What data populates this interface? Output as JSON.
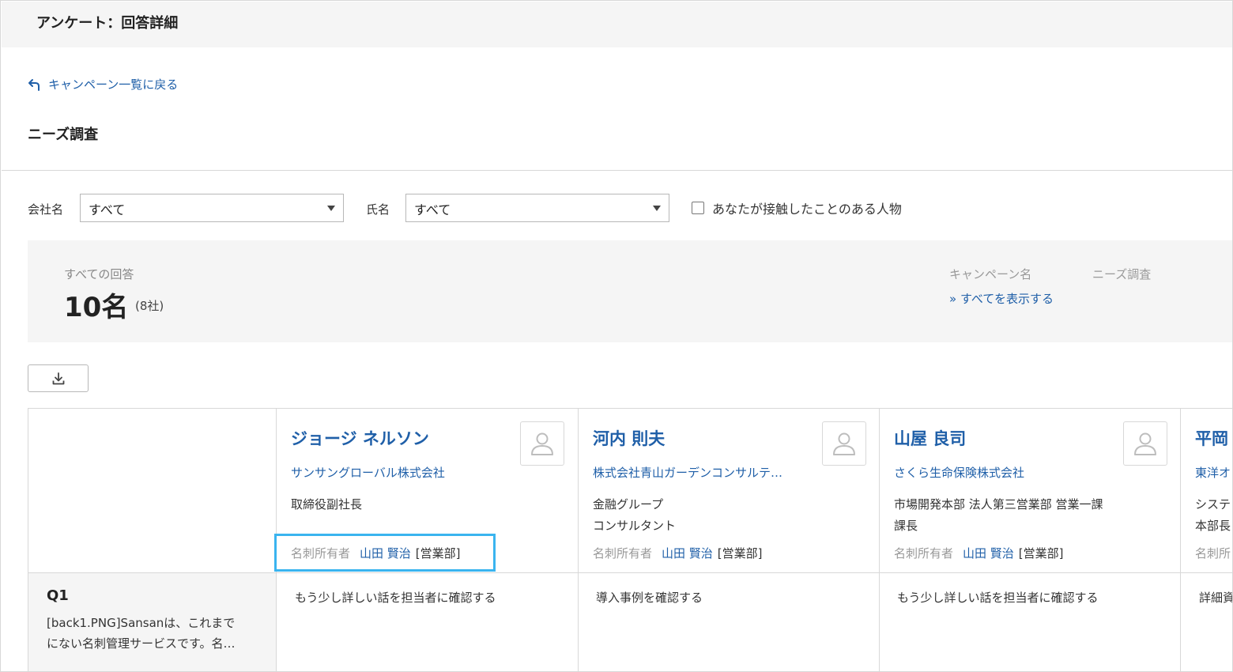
{
  "header": {
    "title": "アンケート：回答詳細"
  },
  "nav": {
    "back_label": "キャンペーン一覧に戻る"
  },
  "survey": {
    "title": "ニーズ調査"
  },
  "filters": {
    "company_label": "会社名",
    "company_value": "すべて",
    "name_label": "氏名",
    "name_value": "すべて",
    "contact_label": "あなたが接触したことのある人物"
  },
  "summary": {
    "label": "すべての回答",
    "count": "10名",
    "companies": "(8社)",
    "campaign_label": "キャンペーン名",
    "campaign_value": "ニーズ調査",
    "show_all": "» すべてを表示する"
  },
  "question": {
    "number": "Q1",
    "text_line1": "[back1.PNG]Sansanは、これまで",
    "text_line2": "にない名刺管理サービスです。名…"
  },
  "people": [
    {
      "name": "ジョージ ネルソン",
      "company": "サンサングローバル株式会社",
      "title_line1": "取締役副社長",
      "title_line2": "",
      "owner_label": "名刺所有者",
      "owner_name": "山田 賢治",
      "owner_dept": "[営業部]",
      "answer": "もう少し詳しい話を担当者に確認する"
    },
    {
      "name": "河内 則夫",
      "company": "株式会社青山ガーデンコンサルテ…",
      "title_line1": "金融グループ",
      "title_line2": "コンサルタント",
      "owner_label": "名刺所有者",
      "owner_name": "山田 賢治",
      "owner_dept": "[営業部]",
      "answer": "導入事例を確認する"
    },
    {
      "name": "山屋 良司",
      "company": "さくら生命保険株式会社",
      "title_line1": "市場開発本部 法人第三営業部 営業一課",
      "title_line2": "課長",
      "owner_label": "名刺所有者",
      "owner_name": "山田 賢治",
      "owner_dept": "[営業部]",
      "answer": "もう少し詳しい話を担当者に確認する"
    },
    {
      "name": "平岡",
      "company": "東洋オ",
      "title_line1": "システ",
      "title_line2": "本部長",
      "owner_label": "名刺所",
      "owner_name": "",
      "owner_dept": "",
      "answer": "詳細資"
    }
  ],
  "colors": {
    "link": "#1f5fa8",
    "highlight": "#3ab4ef",
    "panel": "#f5f5f5"
  }
}
